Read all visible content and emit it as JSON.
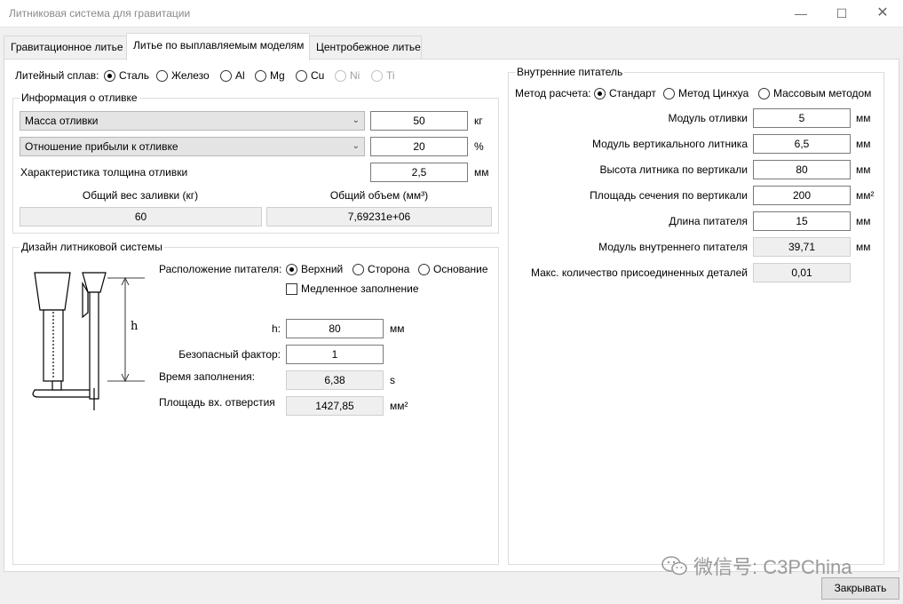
{
  "window": {
    "title": "Литниковая система для гравитации"
  },
  "tabs": [
    {
      "label": "Гравитационное литье"
    },
    {
      "label": "Литье по выплавляемым моделям"
    },
    {
      "label": "Центробежное литье"
    }
  ],
  "alloy": {
    "label": "Литейный сплав:",
    "options": [
      {
        "label": "Сталь",
        "selected": true
      },
      {
        "label": "Железо",
        "selected": false
      },
      {
        "label": "Al",
        "selected": false
      },
      {
        "label": "Mg",
        "selected": false
      },
      {
        "label": "Cu",
        "selected": false
      },
      {
        "label": "Ni",
        "selected": false,
        "disabled": true
      },
      {
        "label": "Ti",
        "selected": false,
        "disabled": true
      }
    ]
  },
  "casting_info": {
    "title": "Информация о отливке",
    "mass_select": "Масса отливки",
    "mass_value": "50",
    "mass_unit": "кг",
    "ratio_select": "Отношение прибыли к отливке",
    "ratio_value": "20",
    "ratio_unit": "%",
    "thickness_label": "Характеристика толщина отливки",
    "thickness_value": "2,5",
    "thickness_unit": "мм",
    "total_weight_label": "Общий вес заливки (кг)",
    "total_volume_label": "Общий объем (мм³)",
    "total_weight_value": "60",
    "total_volume_value": "7,69231e+06"
  },
  "gating_design": {
    "title": "Дизайн литниковой системы",
    "diagram_h_label": "h",
    "position_label": "Расположение питателя:",
    "positions": [
      {
        "label": "Верхний",
        "selected": true
      },
      {
        "label": "Сторона",
        "selected": false
      },
      {
        "label": "Основание",
        "selected": false
      }
    ],
    "slow_fill_label": "Медленное заполнение",
    "h_label": "h:",
    "h_value": "80",
    "h_unit": "мм",
    "safety_label": "Безопасный фактор:",
    "safety_value": "1",
    "fill_time_label": "Время заполнения:",
    "fill_time_value": "6,38",
    "fill_time_unit": "s",
    "inlet_area_label": "Площадь вх. отверстия",
    "inlet_area_value": "1427,85",
    "inlet_area_unit": "мм²"
  },
  "internal_feeder": {
    "title": "Внутренние питатель",
    "method_label": "Метод расчета:",
    "methods": [
      {
        "label": "Стандарт",
        "selected": true
      },
      {
        "label": "Метод Цинхуа",
        "selected": false
      },
      {
        "label": "Массовым методом",
        "selected": false
      }
    ],
    "rows": [
      {
        "label": "Модуль отливки",
        "value": "5",
        "unit": "мм",
        "readonly": false
      },
      {
        "label": "Модуль вертикального литника",
        "value": "6,5",
        "unit": "мм",
        "readonly": false
      },
      {
        "label": "Высота литника по вертикали",
        "value": "80",
        "unit": "мм",
        "readonly": false
      },
      {
        "label": "Площадь сечения по вертикали",
        "value": "200",
        "unit": "мм²",
        "readonly": false
      },
      {
        "label": "Длина питателя",
        "value": "15",
        "unit": "мм",
        "readonly": false
      },
      {
        "label": "Модуль внутреннего питателя",
        "value": "39,71",
        "unit": "мм",
        "readonly": true
      },
      {
        "label": "Макс. количество присоединенных деталей",
        "value": "0,01",
        "unit": "",
        "readonly": true
      }
    ]
  },
  "footer": {
    "close_label": "Закрывать"
  },
  "watermark": {
    "text": "微信号: C3PChina"
  }
}
